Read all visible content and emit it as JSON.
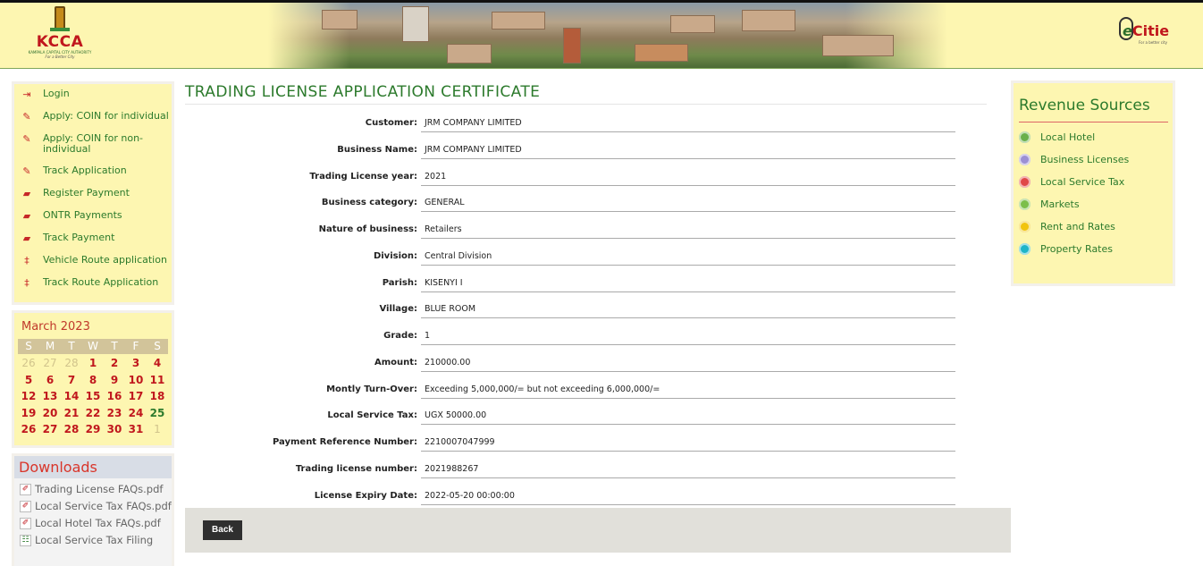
{
  "header": {
    "logo_text": "KCCA",
    "logo_sub": "KAMPALA CAPITAL CITY AUTHORITY",
    "logo_tagline": "For a Better City",
    "ecitie_text": "Citie",
    "ecitie_e": "e",
    "ecitie_tagline": "For a better city"
  },
  "nav": {
    "items": [
      {
        "label": "Login",
        "icon": "login-icon"
      },
      {
        "label": "Apply: COIN for individual",
        "icon": "edit-icon"
      },
      {
        "label": "Apply: COIN for non-individual",
        "icon": "edit-icon"
      },
      {
        "label": "Track Application",
        "icon": "edit-icon"
      },
      {
        "label": "Register Payment",
        "icon": "car-icon"
      },
      {
        "label": "ONTR Payments",
        "icon": "car-icon"
      },
      {
        "label": "Track Payment",
        "icon": "car-icon"
      },
      {
        "label": "Vehicle Route application",
        "icon": "route-icon"
      },
      {
        "label": "Track Route Application",
        "icon": "route-icon"
      }
    ]
  },
  "calendar": {
    "title": "March 2023",
    "weekdays": [
      "S",
      "M",
      "T",
      "W",
      "T",
      "F",
      "S"
    ],
    "days": [
      "26",
      "27",
      "28",
      "1",
      "2",
      "3",
      "4",
      "5",
      "6",
      "7",
      "8",
      "9",
      "10",
      "11",
      "12",
      "13",
      "14",
      "15",
      "16",
      "17",
      "18",
      "19",
      "20",
      "21",
      "22",
      "23",
      "24",
      "25",
      "26",
      "27",
      "28",
      "29",
      "30",
      "31",
      "1"
    ]
  },
  "downloads": {
    "title": "Downloads",
    "items": [
      {
        "label": "Trading License FAQs.pdf"
      },
      {
        "label": "Local Service Tax FAQs.pdf"
      },
      {
        "label": "Local Hotel Tax FAQs.pdf"
      },
      {
        "label": "Local Service Tax Filing"
      }
    ]
  },
  "main": {
    "title": "TRADING LICENSE APPLICATION CERTIFICATE",
    "fields": [
      {
        "label": "Customer:",
        "value": "JRM COMPANY LIMITED"
      },
      {
        "label": "Business Name:",
        "value": "JRM COMPANY LIMITED"
      },
      {
        "label": "Trading License year:",
        "value": "2021"
      },
      {
        "label": "Business category:",
        "value": "GENERAL"
      },
      {
        "label": "Nature of business:",
        "value": "Retailers"
      },
      {
        "label": "Division:",
        "value": "Central Division"
      },
      {
        "label": "Parish:",
        "value": "KISENYI I"
      },
      {
        "label": "Village:",
        "value": "BLUE ROOM"
      },
      {
        "label": "Grade:",
        "value": "1"
      },
      {
        "label": "Amount:",
        "value": "210000.00"
      },
      {
        "label": "Montly Turn-Over:",
        "value": "Exceeding 5,000,000/= but not exceeding 6,000,000/="
      },
      {
        "label": "Local Service Tax:",
        "value": "UGX 50000.00"
      },
      {
        "label": "Payment Reference Number:",
        "value": "2210007047999"
      },
      {
        "label": "Trading license number:",
        "value": "2021988267"
      },
      {
        "label": "License Expiry Date:",
        "value": "2022-05-20 00:00:00"
      }
    ],
    "back_label": "Back"
  },
  "revenue": {
    "title": "Revenue Sources",
    "items": [
      {
        "label": "Local Hotel",
        "color": "#6ab04c"
      },
      {
        "label": "Business Licenses",
        "color": "#9b8fd4"
      },
      {
        "label": "Local Service Tax",
        "color": "#e04848"
      },
      {
        "label": "Markets",
        "color": "#7cbf4a"
      },
      {
        "label": "Rent and Rates",
        "color": "#f1c40f"
      },
      {
        "label": "Property Rates",
        "color": "#1fb5c8"
      }
    ]
  }
}
